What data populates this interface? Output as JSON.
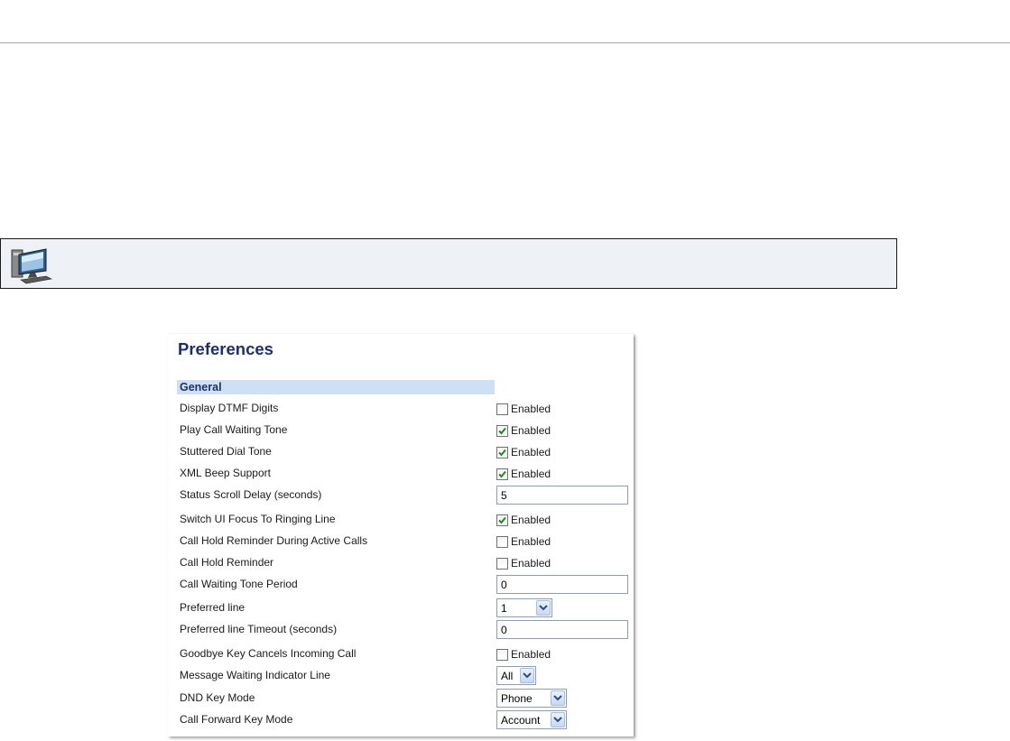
{
  "note": {
    "icon": "computer-monitor-icon"
  },
  "panel": {
    "title": "Preferences",
    "section": "General",
    "rows": [
      {
        "label": "Display DTMF Digits",
        "type": "checkbox",
        "checked": false,
        "option_label": "Enabled"
      },
      {
        "label": "Play Call Waiting Tone",
        "type": "checkbox",
        "checked": true,
        "option_label": "Enabled"
      },
      {
        "label": "Stuttered Dial Tone",
        "type": "checkbox",
        "checked": true,
        "option_label": "Enabled"
      },
      {
        "label": "XML Beep Support",
        "type": "checkbox",
        "checked": true,
        "option_label": "Enabled"
      },
      {
        "label": "Status Scroll Delay (seconds)",
        "type": "text",
        "value": "5"
      },
      {
        "label": "Switch UI Focus To Ringing Line",
        "type": "checkbox",
        "checked": true,
        "option_label": "Enabled"
      },
      {
        "label": "Call Hold Reminder During Active Calls",
        "type": "checkbox",
        "checked": false,
        "option_label": "Enabled"
      },
      {
        "label": "Call Hold Reminder",
        "type": "checkbox",
        "checked": false,
        "option_label": "Enabled"
      },
      {
        "label": "Call Waiting Tone Period",
        "type": "text",
        "value": "0"
      },
      {
        "label": "Preferred line",
        "type": "select",
        "value": "1"
      },
      {
        "label": "Preferred line Timeout (seconds)",
        "type": "text",
        "value": "0"
      },
      {
        "label": "Goodbye Key Cancels Incoming Call",
        "type": "checkbox",
        "checked": false,
        "option_label": "Enabled"
      },
      {
        "label": "Message Waiting Indicator Line",
        "type": "select",
        "value": "All"
      },
      {
        "label": "DND Key Mode",
        "type": "select",
        "value": "Phone"
      },
      {
        "label": "Call Forward Key Mode",
        "type": "select",
        "value": "Account"
      }
    ]
  },
  "colors": {
    "title": "#1f2f6b",
    "section_bg": "#cfe0f5",
    "check": "#1d8a1d",
    "input_border": "#8f9db3"
  }
}
